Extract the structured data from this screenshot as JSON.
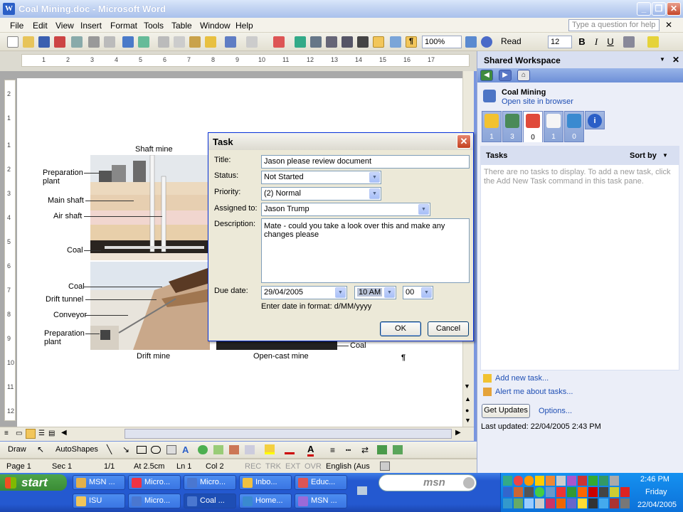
{
  "window": {
    "title": "Coal Mining.doc - Microsoft Word",
    "app_icon": "W"
  },
  "menu": [
    "File",
    "Edit",
    "View",
    "Insert",
    "Format",
    "Tools",
    "Table",
    "Window",
    "Help"
  ],
  "help_placeholder": "Type a question for help",
  "toolbar": {
    "zoom": "100%",
    "read_label": "Read",
    "font_size": "12"
  },
  "ruler": {
    "h_marks": [
      "1",
      "2",
      "3",
      "4",
      "5",
      "6",
      "7",
      "8",
      "9",
      "10",
      "11",
      "12",
      "13",
      "14",
      "15",
      "16",
      "17"
    ],
    "v_marks": [
      "2",
      "1",
      "1",
      "2",
      "3",
      "4",
      "5",
      "6",
      "7",
      "8",
      "9",
      "10",
      "11",
      "12"
    ]
  },
  "diagram": {
    "shaft_title": "Shaft mine",
    "drift_title": "Drift mine",
    "opencast_title": "Open-cast mine",
    "shaft_labels": [
      "Preparation plant",
      "Main shaft",
      "Air shaft",
      "Coal"
    ],
    "drift_labels": [
      "Coal",
      "Drift tunnel",
      "Conveyor",
      "Preparation plant"
    ],
    "opencast_coal": "Coal",
    "pilcrow": "¶"
  },
  "dialog": {
    "title": "Task",
    "title_label": "Title:",
    "title_value": "Jason please review document",
    "status_label": "Status:",
    "status_value": "Not Started",
    "priority_label": "Priority:",
    "priority_value": "(2) Normal",
    "assigned_label": "Assigned to:",
    "assigned_value": "Jason Trump",
    "description_label": "Description:",
    "description_value": "Mate - could you take a look over this and make any changes please",
    "due_label": "Due date:",
    "due_date": "29/04/2005",
    "due_hour": "10 AM",
    "due_min": "00",
    "format_hint": "Enter date in format: d/MM/yyyy",
    "ok": "OK",
    "cancel": "Cancel"
  },
  "taskpane": {
    "header": "Shared Workspace",
    "site_name": "Coal Mining",
    "open_site": "Open site in browser",
    "tab_counts": [
      "1",
      "3",
      "0",
      "1",
      "0"
    ],
    "tasks_heading": "Tasks",
    "sort_by": "Sort by",
    "empty_msg": "There are no tasks to display.  To add a new task, click the Add New Task command in this task pane.",
    "add_task": "Add new task...",
    "alert_me": "Alert me about tasks...",
    "get_updates": "Get Updates",
    "options": "Options...",
    "last_updated": "Last updated: 22/04/2005 2:43 PM"
  },
  "drawbar": {
    "draw": "Draw",
    "autoshapes": "AutoShapes"
  },
  "status": {
    "page": "Page  1",
    "sec": "Sec  1",
    "pages": "1/1",
    "at": "At  2.5cm",
    "ln": "Ln  1",
    "col": "Col  2",
    "rec": "REC",
    "trk": "TRK",
    "ext": "EXT",
    "ovr": "OVR",
    "lang": "English (Aus"
  },
  "taskbar": {
    "start": "start",
    "row1": [
      "MSN ...",
      "Micro...",
      "Micro...",
      "Inbo...",
      "Educ..."
    ],
    "row2": [
      "ISU",
      "Micro...",
      "Coal ...",
      "Home...",
      "MSN ..."
    ],
    "msn": "msn",
    "time": "2:46 PM",
    "day": "Friday",
    "date": "22/04/2005"
  },
  "colors": {
    "accent": "#0831d9",
    "task_link": "#1f4fb4",
    "start_green": "#3a8b35"
  }
}
